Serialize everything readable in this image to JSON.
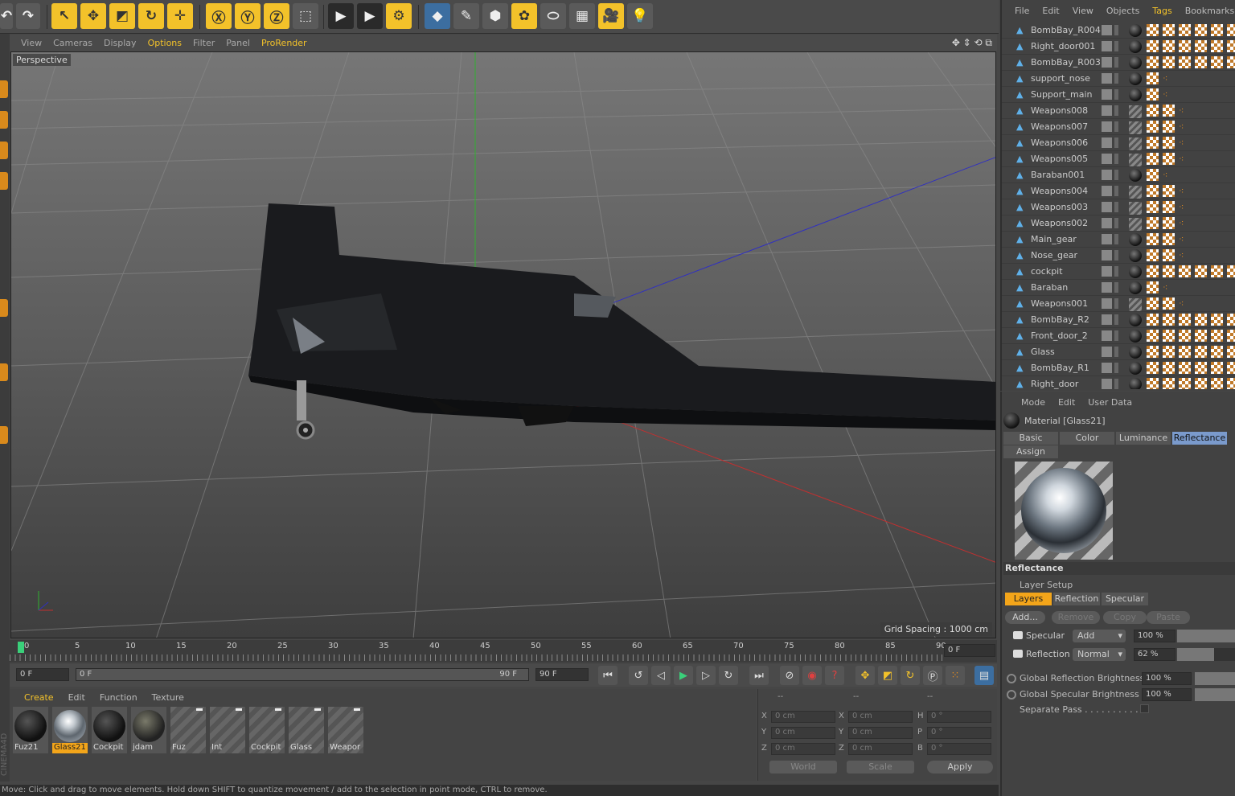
{
  "viewport": {
    "menu": [
      "View",
      "Cameras",
      "Display",
      "Options",
      "Filter",
      "Panel",
      "ProRender"
    ],
    "active_menu": "Options",
    "camera": "Perspective",
    "grid_spacing": "Grid Spacing : 1000 cm"
  },
  "timeline": {
    "ticks": [
      "0",
      "5",
      "10",
      "15",
      "20",
      "25",
      "30",
      "35",
      "40",
      "45",
      "50",
      "55",
      "60",
      "65",
      "70",
      "75",
      "80",
      "85",
      "90"
    ],
    "current_frame": "0 F",
    "start": "0 F",
    "range_start": "0 F",
    "range_end": "90 F",
    "end": "90 F"
  },
  "material_manager": {
    "menu": [
      "Create",
      "Edit",
      "Function",
      "Texture"
    ],
    "materials": [
      {
        "name": "Fuz21",
        "style": "dark-sphere"
      },
      {
        "name": "Glass21",
        "style": "chrome",
        "selected": true
      },
      {
        "name": "Cockpit",
        "style": "dark-sphere"
      },
      {
        "name": "jdam",
        "style": "stripe-sphere"
      },
      {
        "name": "Fuz",
        "style": "empty"
      },
      {
        "name": "Int",
        "style": "empty"
      },
      {
        "name": "Cockpit",
        "style": "empty"
      },
      {
        "name": "Glass",
        "style": "empty"
      },
      {
        "name": "Weapor",
        "style": "empty"
      }
    ]
  },
  "coordinates": {
    "headers": [
      "--",
      "--",
      "--"
    ],
    "rows": [
      {
        "a": "X",
        "av": "0 cm",
        "b": "X",
        "bv": "0 cm",
        "c": "H",
        "cv": "0 °"
      },
      {
        "a": "Y",
        "av": "0 cm",
        "b": "Y",
        "bv": "0 cm",
        "c": "P",
        "cv": "0 °"
      },
      {
        "a": "Z",
        "av": "0 cm",
        "b": "Z",
        "bv": "0 cm",
        "c": "B",
        "cv": "0 °"
      }
    ],
    "space": "World",
    "mode": "Scale",
    "apply": "Apply"
  },
  "status": "Move: Click and drag to move elements. Hold down SHIFT to quantize movement / add to the selection in point mode, CTRL to remove.",
  "objects": {
    "menu": [
      "File",
      "Edit",
      "View",
      "Objects",
      "Tags",
      "Bookmarks"
    ],
    "active_menu": "Tags",
    "rows": [
      {
        "name": "BombBay_R004",
        "mat": "sphere",
        "tags": 6
      },
      {
        "name": "Right_door001",
        "mat": "sphere",
        "tags": 6
      },
      {
        "name": "BombBay_R003",
        "mat": "sphere",
        "tags": 6
      },
      {
        "name": "support_nose",
        "mat": "sphere",
        "tags": 1
      },
      {
        "name": "Support_main",
        "mat": "sphere",
        "tags": 1
      },
      {
        "name": "Weapons008",
        "mat": "stripe",
        "tags": 2
      },
      {
        "name": "Weapons007",
        "mat": "stripe",
        "tags": 2
      },
      {
        "name": "Weapons006",
        "mat": "stripe",
        "tags": 2
      },
      {
        "name": "Weapons005",
        "mat": "stripe",
        "tags": 2
      },
      {
        "name": "Baraban001",
        "mat": "sphere",
        "tags": 1
      },
      {
        "name": "Weapons004",
        "mat": "stripe",
        "tags": 2
      },
      {
        "name": "Weapons003",
        "mat": "stripe",
        "tags": 2
      },
      {
        "name": "Weapons002",
        "mat": "stripe",
        "tags": 2
      },
      {
        "name": "Main_gear",
        "mat": "sphere",
        "tags": 2
      },
      {
        "name": "Nose_gear",
        "mat": "sphere",
        "tags": 2
      },
      {
        "name": "cockpit",
        "mat": "sphere",
        "tags": 6
      },
      {
        "name": "Baraban",
        "mat": "sphere",
        "tags": 1
      },
      {
        "name": "Weapons001",
        "mat": "stripe",
        "tags": 2
      },
      {
        "name": "BombBay_R2",
        "mat": "sphere",
        "tags": 6
      },
      {
        "name": "Front_door_2",
        "mat": "sphere",
        "tags": 6
      },
      {
        "name": "Glass",
        "mat": "sphere",
        "tags": 6
      },
      {
        "name": "BombBay_R1",
        "mat": "sphere",
        "tags": 6
      },
      {
        "name": "Right_door",
        "mat": "sphere",
        "tags": 6
      }
    ]
  },
  "attributes": {
    "menu": [
      "Mode",
      "Edit",
      "User Data"
    ],
    "title": "Material [Glass21]",
    "tabs": [
      "Basic",
      "Color",
      "Luminance",
      "Reflectance"
    ],
    "active_tab": "Reflectance",
    "assign": "Assign",
    "section": "Reflectance",
    "layer_setup": "Layer Setup",
    "subtabs": [
      "Layers",
      "Reflection",
      "Specular"
    ],
    "active_subtab": "Layers",
    "buttons": [
      "Add...",
      "Remove",
      "Copy",
      "Paste"
    ],
    "layers": [
      {
        "name": "Specular",
        "mode": "Add",
        "pct": "100 %",
        "level": 1.0
      },
      {
        "name": "Reflection",
        "mode": "Normal",
        "pct": "62 %",
        "level": 0.62
      }
    ],
    "global_reflection_label": "Global Reflection Brightness",
    "global_reflection": "100 %",
    "global_specular_label": "Global Specular Brightness",
    "global_specular": "100 %",
    "separate_pass": "Separate Pass . . . . . . . . . . ."
  },
  "colors": {
    "accent": "#f3c22a",
    "tab_active": "#7a9acc",
    "axis_x": "#c03030",
    "axis_y": "#30b030",
    "axis_z": "#3030c0"
  }
}
